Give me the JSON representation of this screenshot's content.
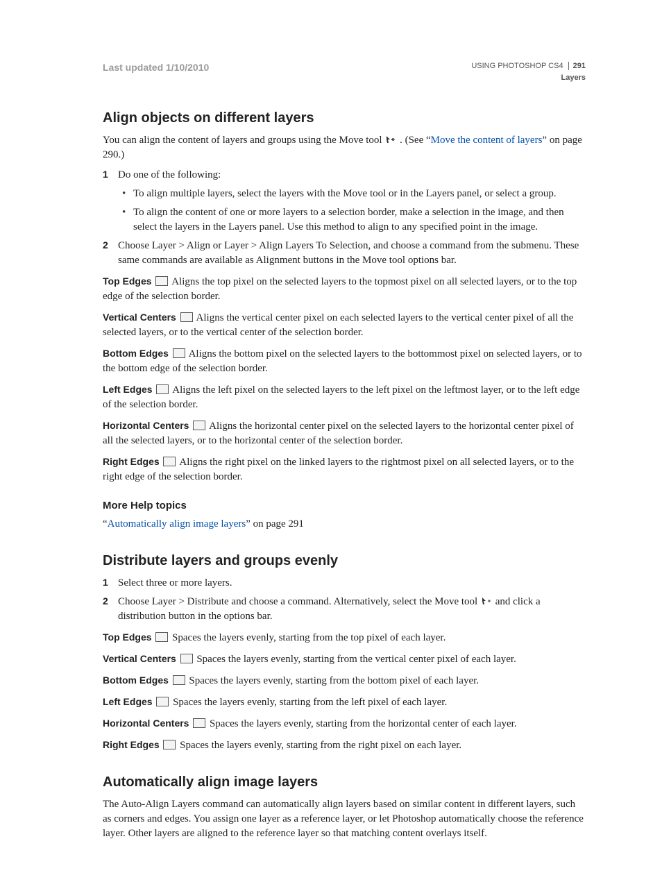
{
  "header": {
    "last_updated": "Last updated 1/10/2010",
    "doc_title": "USING PHOTOSHOP CS4",
    "page_number": "291",
    "section": "Layers"
  },
  "sec1": {
    "title": "Align objects on different layers",
    "intro_a": "You can align the content of layers and groups using the Move tool ",
    "intro_b": ". (See “",
    "intro_link": "Move the content of layers",
    "intro_c": "” on page 290.)",
    "step1": "Do one of the following:",
    "bullet1": "To align multiple layers, select the layers with the Move tool or in the Layers panel, or select a group.",
    "bullet2": "To align the content of one or more layers to a selection border, make a selection in the image, and then select the layers in the Layers panel. Use this method to align to any specified point in the image.",
    "step2": "Choose Layer > Align or Layer > Align Layers To Selection, and choose a command from the submenu. These same commands are available as Alignment buttons in the Move tool options bar.",
    "defs": {
      "top_edges_label": "Top Edges",
      "top_edges_desc": "Aligns the top pixel on the selected layers to the topmost pixel on all selected layers, or to the top edge of the selection border.",
      "vertical_centers_label": "Vertical Centers",
      "vertical_centers_desc": "Aligns the vertical center pixel on each selected layers to the vertical center pixel of all the selected layers, or to the vertical center of the selection border.",
      "bottom_edges_label": "Bottom Edges",
      "bottom_edges_desc": "Aligns the bottom pixel on the selected layers to the bottommost pixel on selected layers, or to the bottom edge of the selection border.",
      "left_edges_label": "Left Edges",
      "left_edges_desc": "Aligns the left pixel on the selected layers to the left pixel on the leftmost layer, or to the left edge of the selection border.",
      "horizontal_centers_label": "Horizontal Centers",
      "horizontal_centers_desc": "Aligns the horizontal center pixel on the selected layers to the horizontal center pixel of all the selected layers, or to the horizontal center of the selection border.",
      "right_edges_label": "Right Edges",
      "right_edges_desc": "Aligns the right pixel on the linked layers to the rightmost pixel on all selected layers, or to the right edge of the selection border."
    },
    "more_help_title": "More Help topics",
    "more_help_q1": "“",
    "more_help_link": "Automatically align image layers",
    "more_help_q2": "” on page 291"
  },
  "sec2": {
    "title": "Distribute layers and groups evenly",
    "step1": "Select three or more layers.",
    "step2a": "Choose Layer > Distribute and choose a command. Alternatively, select the Move tool ",
    "step2b": " and click a distribution button in the options bar.",
    "defs": {
      "top_edges_label": "Top Edges",
      "top_edges_desc": "Spaces the layers evenly, starting from the top pixel of each layer.",
      "vertical_centers_label": "Vertical Centers",
      "vertical_centers_desc": "Spaces the layers evenly, starting from the vertical center pixel of each layer.",
      "bottom_edges_label": "Bottom Edges",
      "bottom_edges_desc": "Spaces the layers evenly, starting from the bottom pixel of each layer.",
      "left_edges_label": "Left Edges",
      "left_edges_desc": "Spaces the layers evenly, starting from the left pixel of each layer.",
      "horizontal_centers_label": "Horizontal Centers",
      "horizontal_centers_desc": "Spaces the layers evenly, starting from the horizontal center of each layer.",
      "right_edges_label": "Right Edges",
      "right_edges_desc": "Spaces the layers evenly, starting from the right pixel on each layer."
    }
  },
  "sec3": {
    "title": "Automatically align image layers",
    "body": "The Auto-Align Layers command can automatically align layers based on similar content in different layers, such as corners and edges. You assign one layer as a reference layer, or let Photoshop automatically choose the reference layer. Other layers are aligned to the reference layer so that matching content overlays itself."
  }
}
